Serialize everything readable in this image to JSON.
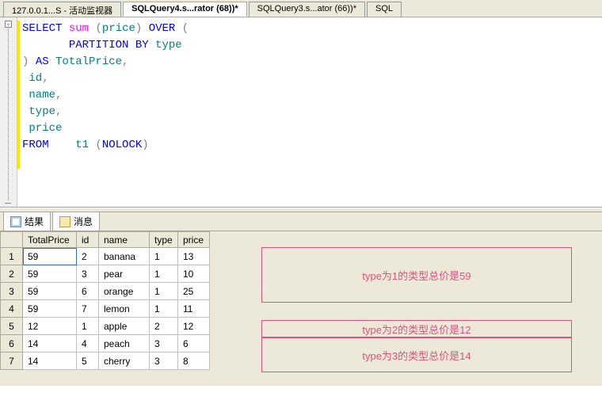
{
  "tabs": {
    "tab1": "127.0.0.1...S - 活动监视器",
    "tab2": "SQLQuery4.s...rator (68))*",
    "tab3": "SQLQuery3.s...ator (66))*",
    "tab4": "SQL"
  },
  "sql": {
    "line1_select": "SELECT",
    "line1_sum": "sum",
    "line1_paren1": " (",
    "line1_price": "price",
    "line1_paren2": ") ",
    "line1_over": "OVER",
    "line1_paren3": " (",
    "line2_indent": "       ",
    "line2_partition": "PARTITION",
    "line2_by": " BY",
    "line2_type": " type",
    "line3_paren": ") ",
    "line3_as": "AS",
    "line3_total": " TotalPrice",
    "line3_comma": ",",
    "line4": " id",
    "line4_comma": ",",
    "line5": " name",
    "line5_comma": ",",
    "line6": " type",
    "line6_comma": ",",
    "line7": " price",
    "line8_from": "FROM",
    "line8_sp": "    ",
    "line8_t1": "t1",
    "line8_paren1": " (",
    "line8_nolock": "NOLOCK",
    "line8_paren2": ")"
  },
  "result_tabs": {
    "results": "结果",
    "messages": "消息"
  },
  "grid": {
    "headers": {
      "totalprice": "TotalPrice",
      "id": "id",
      "name": "name",
      "type": "type",
      "price": "price"
    },
    "rows": [
      {
        "n": "1",
        "totalprice": "59",
        "id": "2",
        "name": "banana",
        "type": "1",
        "price": "13"
      },
      {
        "n": "2",
        "totalprice": "59",
        "id": "3",
        "name": "pear",
        "type": "1",
        "price": "10"
      },
      {
        "n": "3",
        "totalprice": "59",
        "id": "6",
        "name": "orange",
        "type": "1",
        "price": "25"
      },
      {
        "n": "4",
        "totalprice": "59",
        "id": "7",
        "name": "lemon",
        "type": "1",
        "price": "11"
      },
      {
        "n": "5",
        "totalprice": "12",
        "id": "1",
        "name": "apple",
        "type": "2",
        "price": "12"
      },
      {
        "n": "6",
        "totalprice": "14",
        "id": "4",
        "name": "peach",
        "type": "3",
        "price": "6"
      },
      {
        "n": "7",
        "totalprice": "14",
        "id": "5",
        "name": "cherry",
        "type": "3",
        "price": "8"
      }
    ]
  },
  "annotations": {
    "a1": "type为1的类型总价是59",
    "a2": "type为2的类型总价是12",
    "a3": "type为3的类型总价是14"
  }
}
